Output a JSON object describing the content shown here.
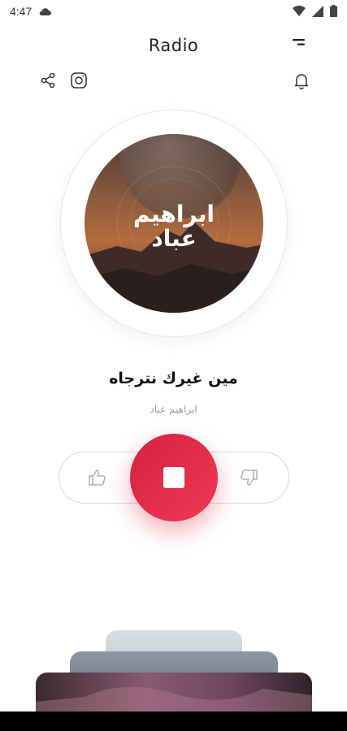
{
  "status_bar": {
    "time": "4:47"
  },
  "header": {
    "title": "Radio"
  },
  "now_playing": {
    "cover_text_line1": "ابراهيم",
    "cover_text_line2": "عباد",
    "title": "مين غيرك نترجاه",
    "artist": "ابراهيم عباد",
    "state": "playing"
  },
  "colors": {
    "accent": "#d4213d",
    "accent_light": "#ee3a55",
    "muted_text": "#9a9a9a"
  },
  "icons": [
    "share-icon",
    "instagram-icon",
    "bell-icon",
    "menu-icon",
    "thumbs-up-icon",
    "thumbs-down-icon",
    "stop-icon"
  ]
}
